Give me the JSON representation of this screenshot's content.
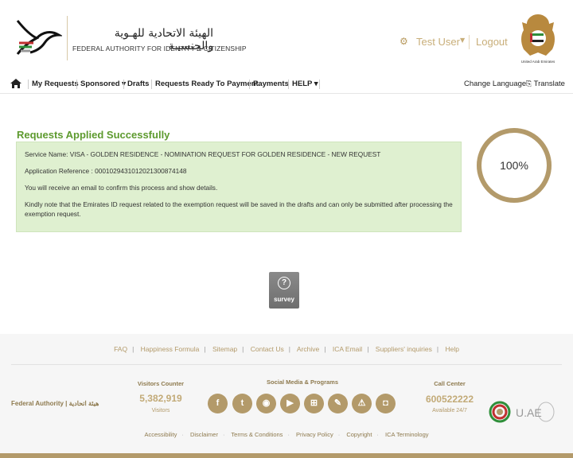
{
  "header": {
    "logo_ar": "الهيئة الاتحادية للهـوية والجنسيـة",
    "logo_en": "FEDERAL AUTHORITY FOR IDENTITY & CITIZENSHIP",
    "user_name": "Test User",
    "logout_label": "Logout",
    "emblem_caption": "United Arab Emirates"
  },
  "nav": {
    "items": [
      "My Requests",
      "Sponsored ▾",
      "Drafts",
      "Requests Ready To Payment",
      "Payments",
      "HELP ▾"
    ],
    "change_language": "Change Language",
    "translate": "Translate"
  },
  "main": {
    "title": "Requests Applied Successfully",
    "service_name": "Service Name: VISA - GOLDEN RESIDENCE - NOMINATION REQUEST FOR GOLDEN RESIDENCE - NEW REQUEST",
    "application_reference": "Application Reference : 000102943101202130087414​8",
    "email_note": "You will receive an email to confirm this process and show details.",
    "note_line1": "Kindly note that the Emirates ID request related to the exemption request will be saved in the drafts and can only be submitted after processing the",
    "note_line2": "exemption request.",
    "progress": 100,
    "progress_label": "100%",
    "survey_label": "survey"
  },
  "footer": {
    "links": [
      "FAQ",
      "Happiness Formula",
      "Sitemap",
      "Contact Us",
      "Archive",
      "ICA Email",
      "Suppliers' inquiries",
      "Help"
    ],
    "authority_label": "Federal Authority  |  هيئة اتحادية",
    "visitors_title": "Visitors Counter",
    "visitors_count": "5,382,919",
    "visitors_sub": "Visitors",
    "social_title": "Social Media & Programs",
    "call_title": "Call Center",
    "call_number": "600522222",
    "call_sub": "Available 24/7",
    "uae_logo_text": "U.AE",
    "bottom_links": [
      "Accessibility",
      "Disclaimer",
      "Terms & Conditions",
      "Privacy Policy",
      "Copyright",
      "ICA Terminology"
    ]
  },
  "colors": {
    "accent_gold": "#b39a6a",
    "success_green": "#5d9a2e",
    "success_bg": "#dff0d0"
  }
}
